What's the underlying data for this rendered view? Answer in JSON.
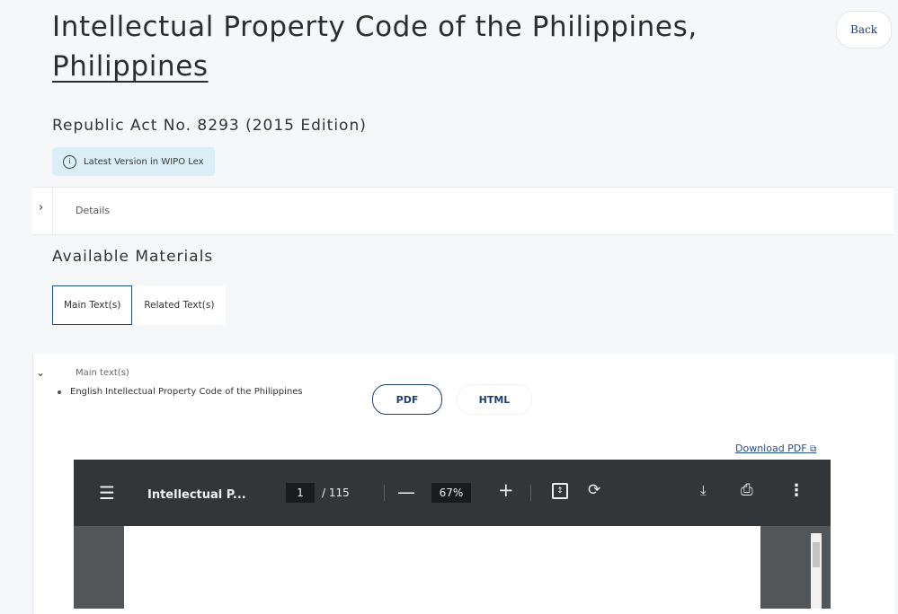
{
  "header": {
    "title_line1": "Intellectual Property Code of the Philippines,",
    "title_line2": "Philippines",
    "back_label": "Back",
    "subtitle": "Republic Act No. 8293 (2015 Edition)",
    "badge": {
      "icon": "info-icon",
      "label": "Latest Version in WIPO Lex",
      "color": "#d9eef6"
    }
  },
  "details": {
    "label": "Details",
    "icon": "chevron-right-icon"
  },
  "materials": {
    "title": "Available Materials",
    "tabs": [
      {
        "label": "Main Text(s)",
        "active": true
      },
      {
        "label": "Related Text(s)",
        "active": false
      }
    ],
    "main": {
      "label": "Main text(s)",
      "language": "English",
      "doc_title": "Intellectual Property Code of the Philippines",
      "pdf_label": "PDF",
      "html_label": "HTML",
      "download_label": "Download PDF",
      "expand_icon": "chevron-down-icon"
    }
  },
  "viewer": {
    "title": "Intellectual P...",
    "page": "1",
    "page_total": "/ 115",
    "zoom": "67%",
    "minus": "—",
    "plus": "+",
    "icons": [
      "menu-icon",
      "fit-page-icon",
      "rotate-icon",
      "download-icon",
      "print-icon",
      "more-icon"
    ]
  },
  "colors": {
    "accent": "#1f3f77",
    "badge_bg": "#d9eef6",
    "viewer_toolbar": "#323639"
  }
}
